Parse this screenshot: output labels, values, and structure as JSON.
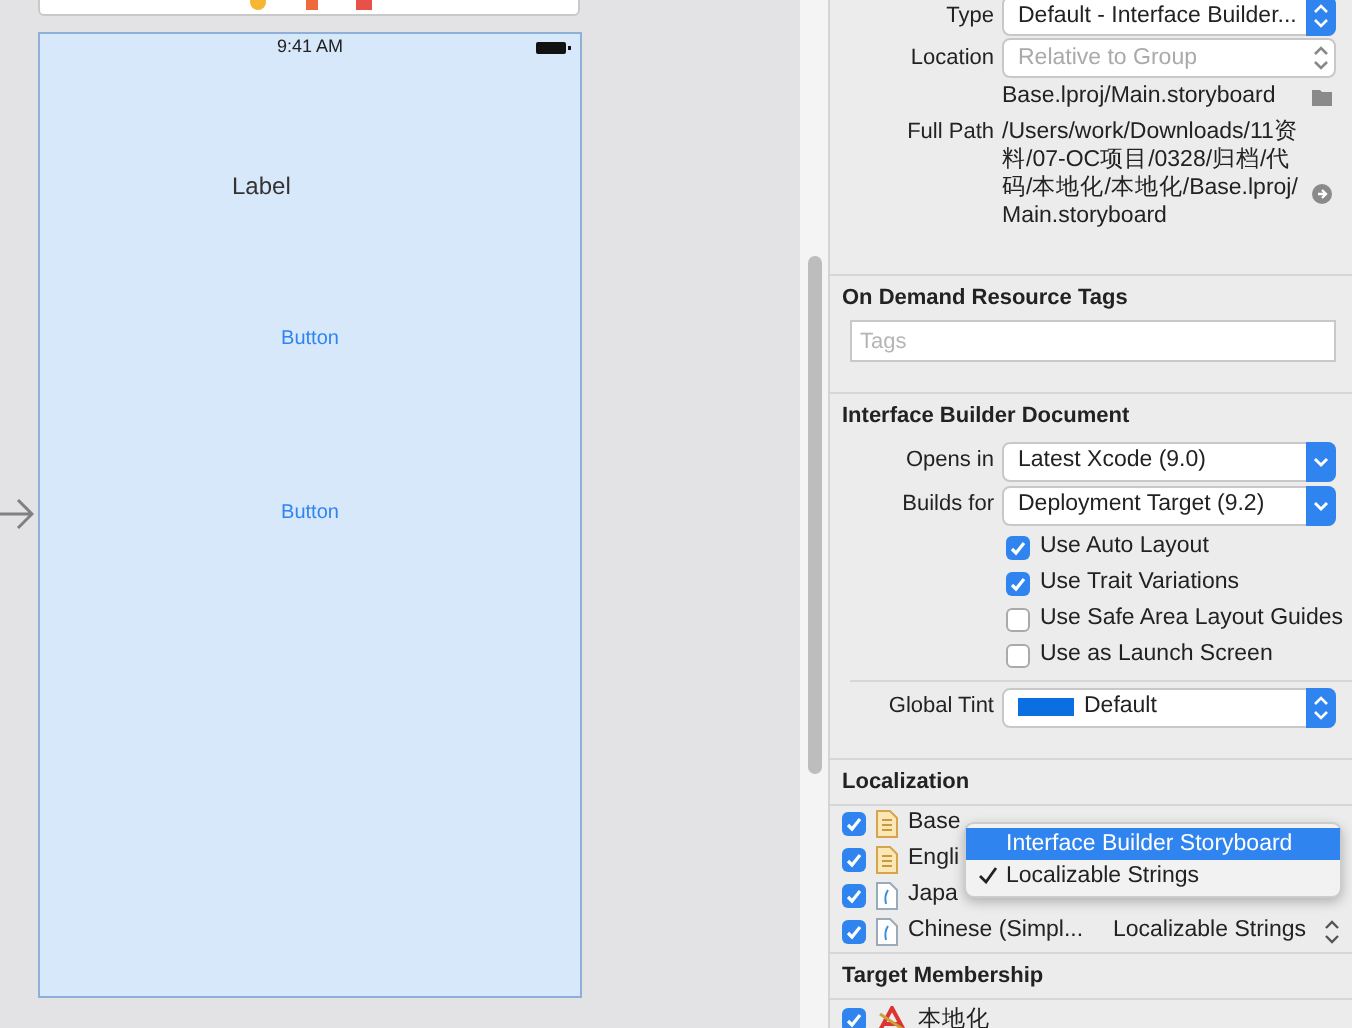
{
  "canvas": {
    "status_time": "9:41 AM",
    "label": "Label",
    "buttons": [
      "Button",
      "Button"
    ]
  },
  "file": {
    "type_label": "Type",
    "type": "Default - Interface Builder...",
    "location_label": "Location",
    "location": "Relative to Group",
    "location_disabled": true,
    "path": "Base.lproj/Main.storyboard",
    "full_path_label": "Full Path",
    "full_path": "/Users/work/Downloads/11资料/07-OC项目/0328/归档/代码/本地化/本地化/Base.lproj/Main.storyboard"
  },
  "resource_tags": {
    "title": "On Demand Resource Tags",
    "placeholder": "Tags"
  },
  "ib_document": {
    "title": "Interface Builder Document",
    "opens_in_label": "Opens in",
    "opens_in": "Latest Xcode (9.0)",
    "builds_for_label": "Builds for",
    "builds_for": "Deployment Target (9.2)",
    "options": [
      {
        "label": "Use Auto Layout",
        "checked": true
      },
      {
        "label": "Use Trait Variations",
        "checked": true
      },
      {
        "label": "Use Safe Area Layout Guides",
        "checked": false
      },
      {
        "label": "Use as Launch Screen",
        "checked": false
      }
    ],
    "global_tint_label": "Global Tint",
    "global_tint": "Default"
  },
  "localization": {
    "title": "Localization",
    "rows": [
      {
        "name": "Base",
        "checked": true,
        "kind": "storyboard"
      },
      {
        "name": "Engli",
        "checked": true,
        "kind": "storyboard"
      },
      {
        "name": "Japa",
        "checked": true,
        "kind": "strings"
      },
      {
        "name": "Chinese (Simpl...",
        "checked": true,
        "kind": "strings",
        "file_type": "Localizable Strings"
      }
    ]
  },
  "file_type_menu": [
    {
      "label": "Interface Builder Storyboard",
      "selected": true,
      "checked": false
    },
    {
      "label": "Localizable Strings",
      "selected": false,
      "checked": true
    }
  ],
  "target_membership": {
    "title": "Target Membership",
    "targets": [
      {
        "name": "本地化",
        "checked": true
      }
    ]
  }
}
